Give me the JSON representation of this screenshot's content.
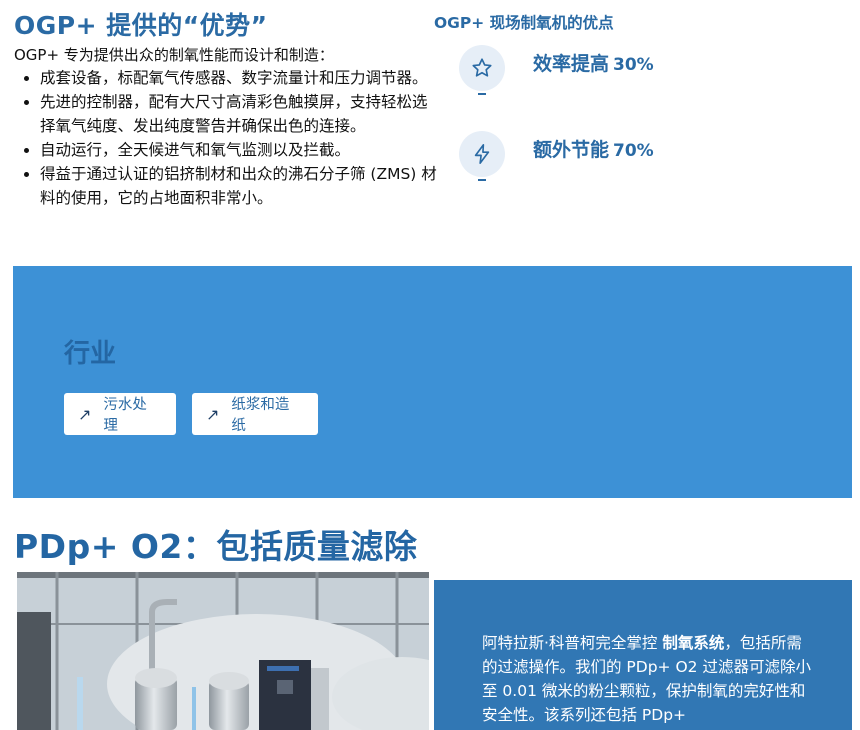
{
  "ogp": {
    "title": "OGP+ 提供的“优势”",
    "intro": "OGP+ 专为提供出众的制氧性能而设计和制造：",
    "bullets": [
      "成套设备，标配氧气传感器、数字流量计和压力调节器。",
      "先进的控制器，配有大尺寸高清彩色触摸屏，支持轻松选择氧气纯度、发出纯度警告并确保出色的连接。",
      "自动运行，全天候进气和氧气监测以及拦截。",
      "得益于通过认证的铝挤制材和出众的沸石分子筛 (ZMS) 材料的使用，它的占地面积非常小。"
    ]
  },
  "advantages": {
    "title": "OGP+ 现场制氧机的优点",
    "items": [
      {
        "label": "效率提高",
        "value": "30%",
        "icon": "star-icon"
      },
      {
        "label": "额外节能",
        "value": "70%",
        "icon": "lightning-icon"
      }
    ]
  },
  "industry": {
    "title": "行业",
    "tags": [
      {
        "label": "污水处理",
        "icon": "arrow-up-right-icon"
      },
      {
        "label": "纸浆和造纸",
        "icon": "arrow-up-right-icon"
      }
    ]
  },
  "pdp": {
    "title": "PDp+ O2：包括质量滤除",
    "text_before": "阿特拉斯·科普柯完全掌控 ",
    "text_bold": "制氧系统",
    "text_after": "，包括所需的过滤操作。我们的 PDp+ O2 过滤器可滤除小至 0.01 微米的粉尘颗粒，保护制氧的完好性和安全性。该系列还包括 PDp+"
  },
  "colors": {
    "brand_blue": "#2a6aa4",
    "industry_bg": "#3d91d6",
    "pdp_box_bg": "#3177b4"
  }
}
